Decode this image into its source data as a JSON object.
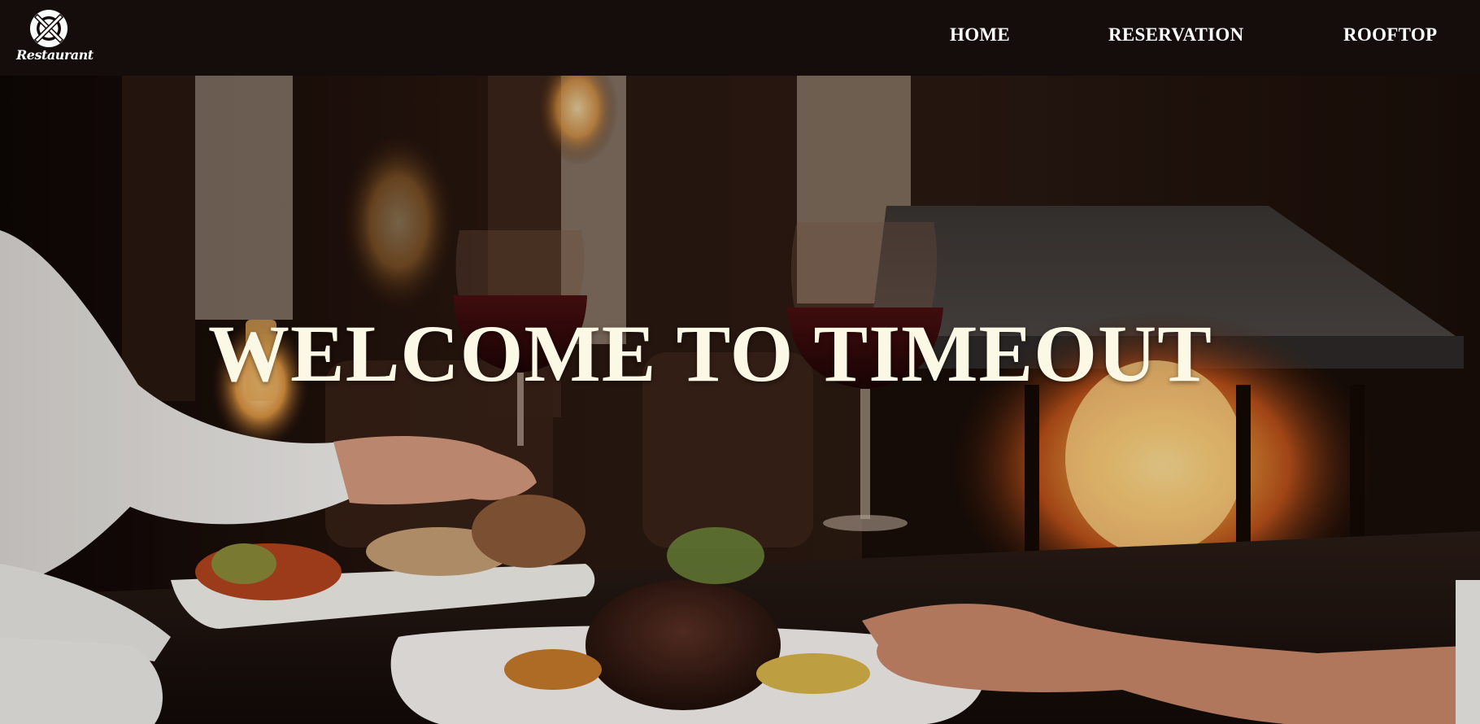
{
  "header": {
    "logo": {
      "icon": "plate-fork-knife-icon",
      "text": "Restaurant"
    },
    "nav": {
      "home": "HOME",
      "reservation": "RESERVATION",
      "rooftop": "ROOFTOP"
    }
  },
  "hero": {
    "title": "WELCOME TO TIMEOUT",
    "image": "restaurant-dinner-fireplace-photo"
  },
  "colors": {
    "navbar_bg": "#150d0c",
    "nav_text": "#ffffff",
    "title_text": "#fbf8e6"
  }
}
